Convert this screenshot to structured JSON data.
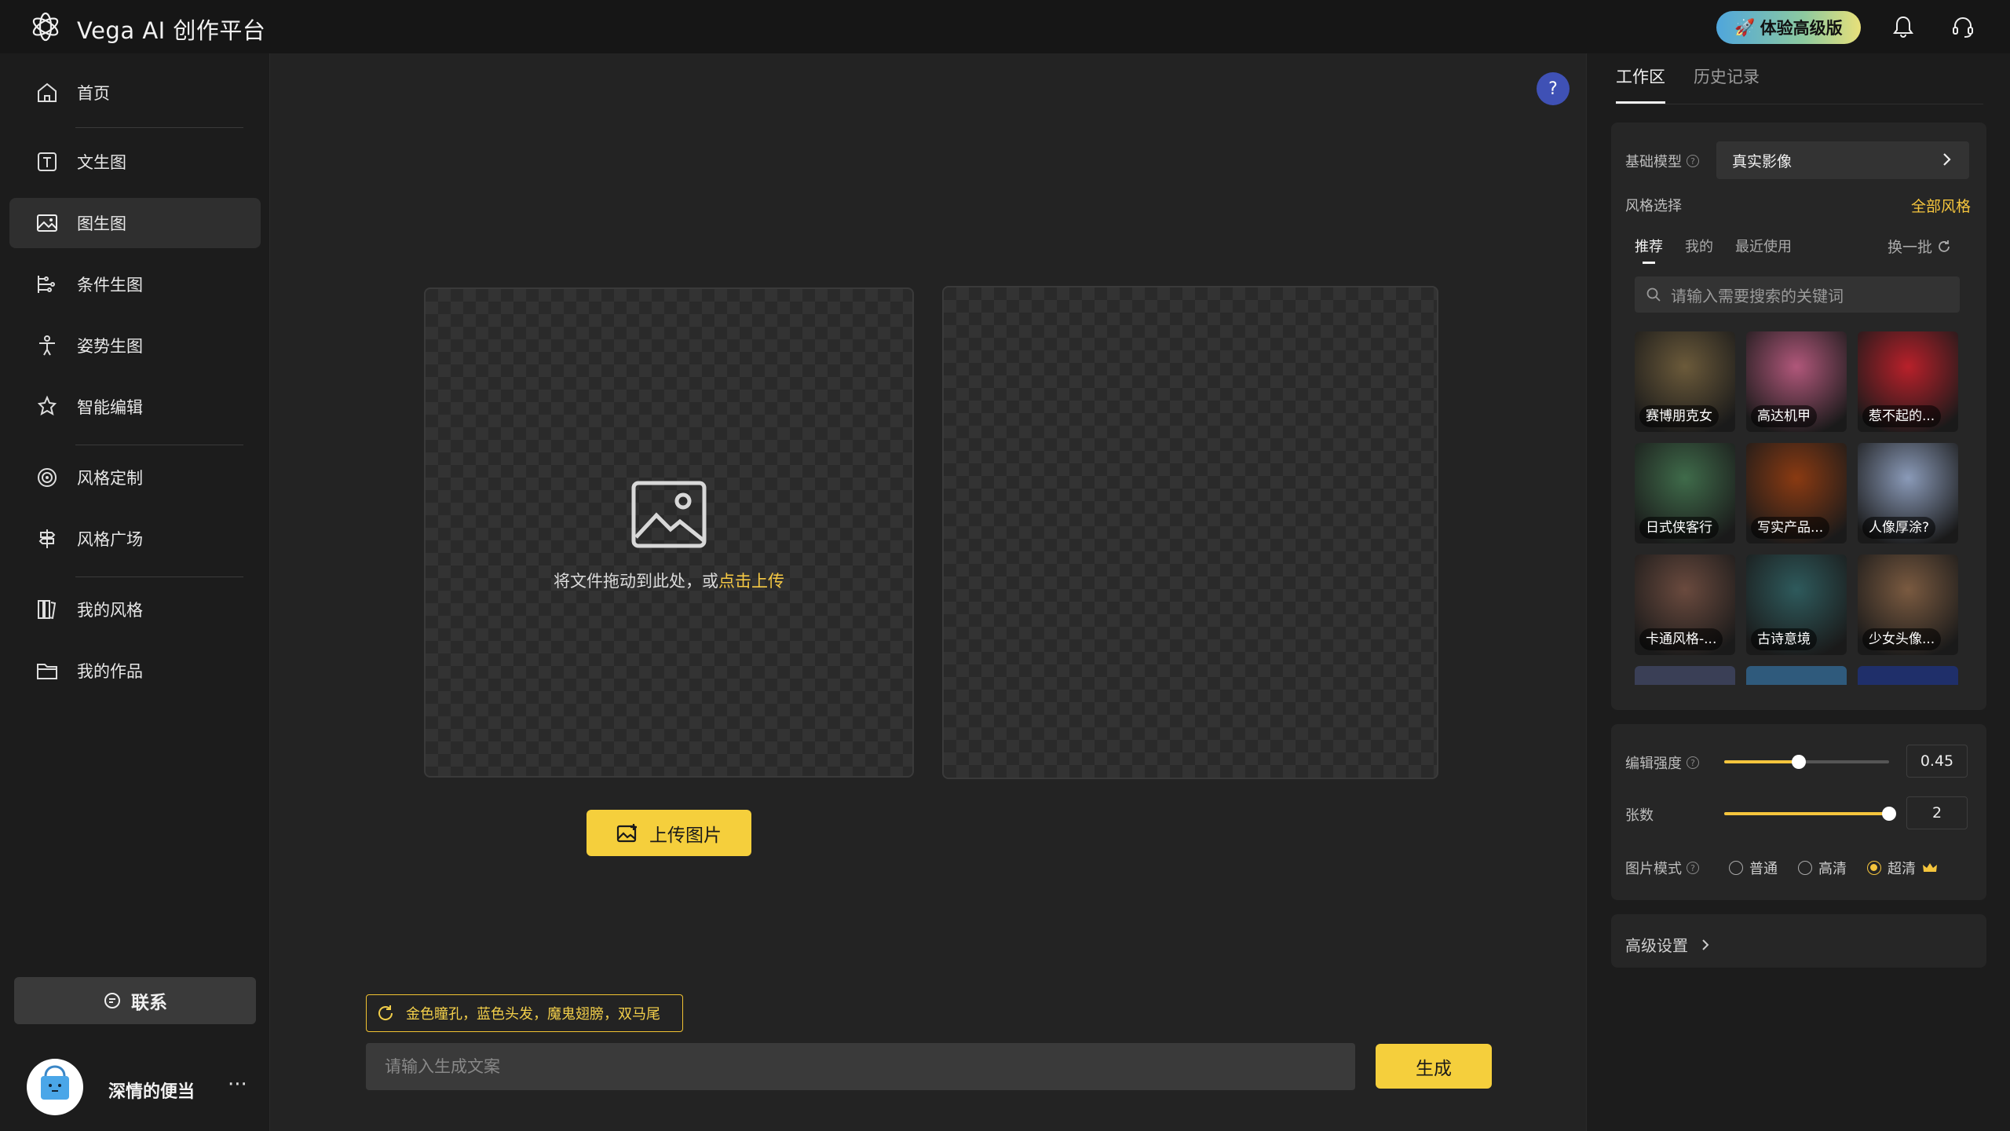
{
  "header": {
    "app_title": "Vega AI 创作平台",
    "upgrade_label": "体验高级版",
    "logo_icon": "atom-logo-icon",
    "bell_icon": "bell-icon",
    "support_icon": "headset-icon"
  },
  "sidebar": {
    "items": [
      {
        "label": "首页",
        "icon": "home-icon"
      },
      {
        "label": "文生图",
        "icon": "text-to-image-icon"
      },
      {
        "label": "图生图",
        "icon": "image-icon",
        "active": true
      },
      {
        "label": "条件生图",
        "icon": "condition-icon"
      },
      {
        "label": "姿势生图",
        "icon": "pose-icon"
      },
      {
        "label": "智能编辑",
        "icon": "magic-edit-icon"
      },
      {
        "label": "风格定制",
        "icon": "target-icon"
      },
      {
        "label": "风格广场",
        "icon": "signpost-icon"
      },
      {
        "label": "我的风格",
        "icon": "books-icon"
      },
      {
        "label": "我的作品",
        "icon": "folder-icon"
      }
    ],
    "contact_label": "联系",
    "user_name": "深情的便当",
    "more_label": "···"
  },
  "main": {
    "help_label": "?",
    "upload_hint_prefix": "将文件拖动到此处，或",
    "upload_hint_link": "点击上传",
    "upload_button": "上传图片",
    "suggestion_chip": "金色瞳孔，蓝色头发，魔鬼翅膀，双马尾",
    "prompt_placeholder": "请输入生成文案",
    "generate_button": "生成"
  },
  "right_panel": {
    "tabs": [
      {
        "label": "工作区",
        "active": true
      },
      {
        "label": "历史记录",
        "active": false
      }
    ],
    "base_model_label": "基础模型",
    "base_model_value": "真实影像",
    "style_select_label": "风格选择",
    "all_styles_link": "全部风格",
    "style_tabs": [
      {
        "label": "推荐",
        "active": true
      },
      {
        "label": "我的",
        "active": false
      },
      {
        "label": "最近使用",
        "active": false
      }
    ],
    "refresh_label": "换一批",
    "search_placeholder": "请输入需要搜索的关键词",
    "styles": [
      {
        "label": "赛博朋克女",
        "color": "#6b5a3a"
      },
      {
        "label": "高达机甲",
        "color": "#b0577a"
      },
      {
        "label": "惹不起的...",
        "color": "#b8202a"
      },
      {
        "label": "日式侠客行",
        "color": "#3f6b4a"
      },
      {
        "label": "写实产品...",
        "color": "#8a3a12"
      },
      {
        "label": "人像厚涂?",
        "color": "#8a9ab8"
      },
      {
        "label": "卡通风格-...",
        "color": "#6a4a3e"
      },
      {
        "label": "古诗意境",
        "color": "#2e5a5c"
      },
      {
        "label": "少女头像...",
        "color": "#7a5a40"
      }
    ],
    "edit_strength_label": "编辑强度",
    "edit_strength_value": "0.45",
    "edit_strength_fraction": 0.45,
    "count_label": "张数",
    "count_value": "2",
    "count_fraction": 1.0,
    "image_mode_label": "图片模式",
    "image_modes": [
      {
        "label": "普通",
        "selected": false
      },
      {
        "label": "高清",
        "selected": false
      },
      {
        "label": "超清",
        "selected": true
      }
    ],
    "advanced_label": "高级设置"
  },
  "colors": {
    "accent": "#f5cf3c",
    "background": "#222222",
    "help_blue": "#3f51b5"
  }
}
